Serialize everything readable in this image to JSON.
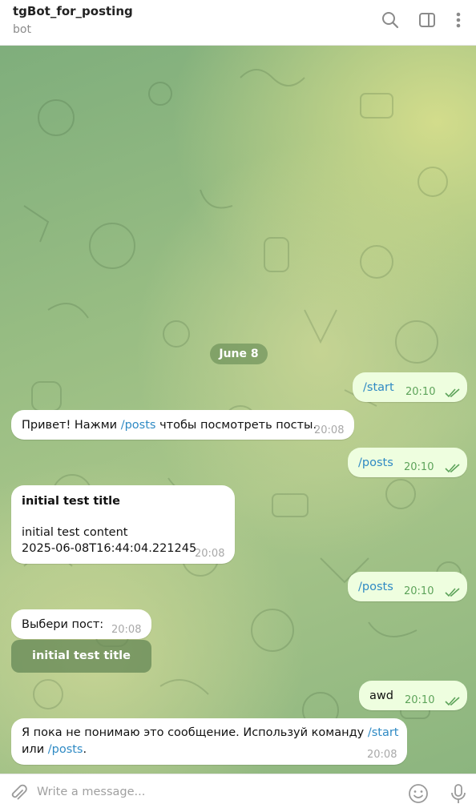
{
  "header": {
    "title": "tgBot_for_posting",
    "status": "bot",
    "icons": [
      "search-icon",
      "sidebar-toggle-icon",
      "more-vertical-icon"
    ]
  },
  "chat": {
    "date": "June 8",
    "messages": [
      {
        "dir": "out",
        "text": "/start",
        "time": "20:10"
      },
      {
        "dir": "in",
        "text_pre": "Привет! Нажми ",
        "link": "/posts",
        "text_post": " чтобы посмотреть посты.",
        "time": "20:08"
      },
      {
        "dir": "out",
        "text": "/posts",
        "time": "20:10"
      },
      {
        "dir": "in",
        "title": "initial test title",
        "content": "initial test content",
        "date": "2025-06-08T16:44:04.221245",
        "time": "20:08"
      },
      {
        "dir": "out",
        "text": "/posts",
        "time": "20:10"
      },
      {
        "dir": "in",
        "text": "Выбери пост:",
        "time": "20:08",
        "button": "initial test title"
      },
      {
        "dir": "out",
        "text": "awd",
        "time": "20:10"
      },
      {
        "dir": "in",
        "line1_pre": "Я пока не понимаю это сообщение. Используй команду ",
        "line1_link": "/start",
        "line2_pre": "или ",
        "line2_link": "/posts",
        "line2_post": ".",
        "time": "20:08"
      }
    ]
  },
  "composer": {
    "placeholder": "Write a message...",
    "icons": [
      "attach-icon",
      "emoji-icon",
      "microphone-icon"
    ]
  },
  "colors": {
    "link": "#2f8ac4",
    "outgoing_bubble": "#eefedf",
    "read_ticks": "#5da35a"
  }
}
